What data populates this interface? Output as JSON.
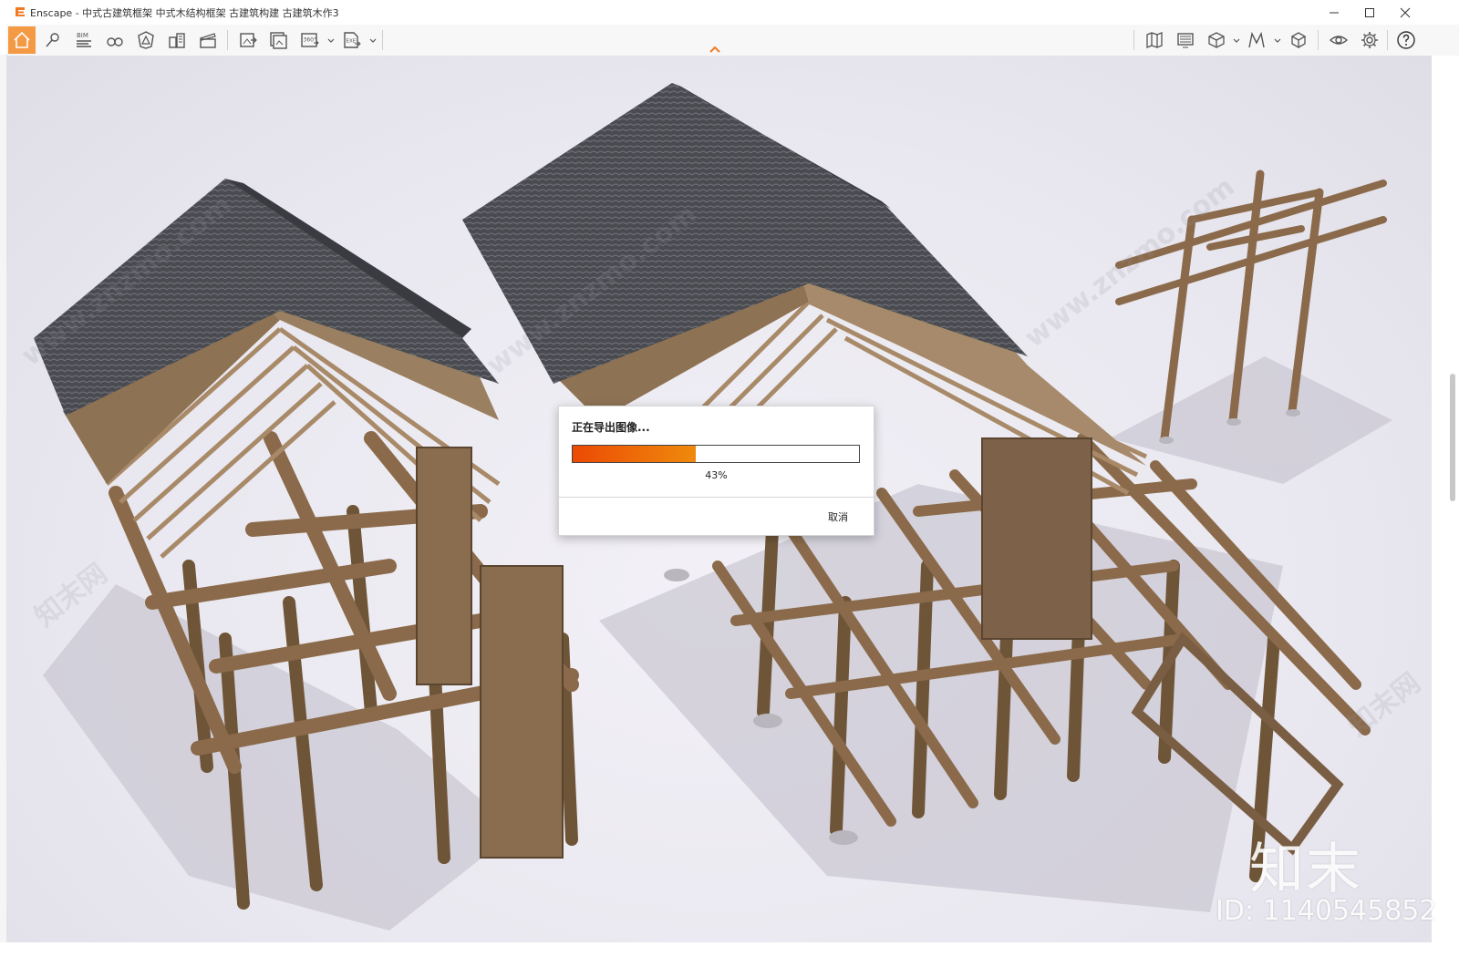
{
  "window": {
    "app_name": "Enscape",
    "title": "Enscape - 中式古建筑框架 中式木结构框架 古建筑构建 古建筑木作3",
    "brand_color": "#f07a22"
  },
  "toolbar": {
    "left_icons": [
      "home-icon",
      "location-pin-icon",
      "bim-icon",
      "binoculars-icon",
      "shield-icon",
      "buildings-icon",
      "clapperboard-icon",
      "export-image-icon",
      "batch-render-icon",
      "panorama-360-icon",
      "exe-export-icon"
    ],
    "bim_label": "BIM",
    "pano_label": "360°",
    "exe_label": "EXE",
    "right_icons": [
      "map-book-icon",
      "display-icon",
      "cube-view-icon",
      "material-icon",
      "asset-library-icon",
      "visual-settings-icon",
      "gear-icon",
      "help-icon"
    ]
  },
  "dialog": {
    "message": "正在导出图像...",
    "progress": 0.43,
    "percent_text": "43%",
    "cancel_label": "取消",
    "progress_color_start": "#ec4a04",
    "progress_color_end": "#ef8a0c"
  },
  "watermarks": {
    "site_text": "www.znzmo.com",
    "brand_text": "知末网",
    "corner_logo": "知末",
    "corner_id": "ID: 1140545852"
  }
}
